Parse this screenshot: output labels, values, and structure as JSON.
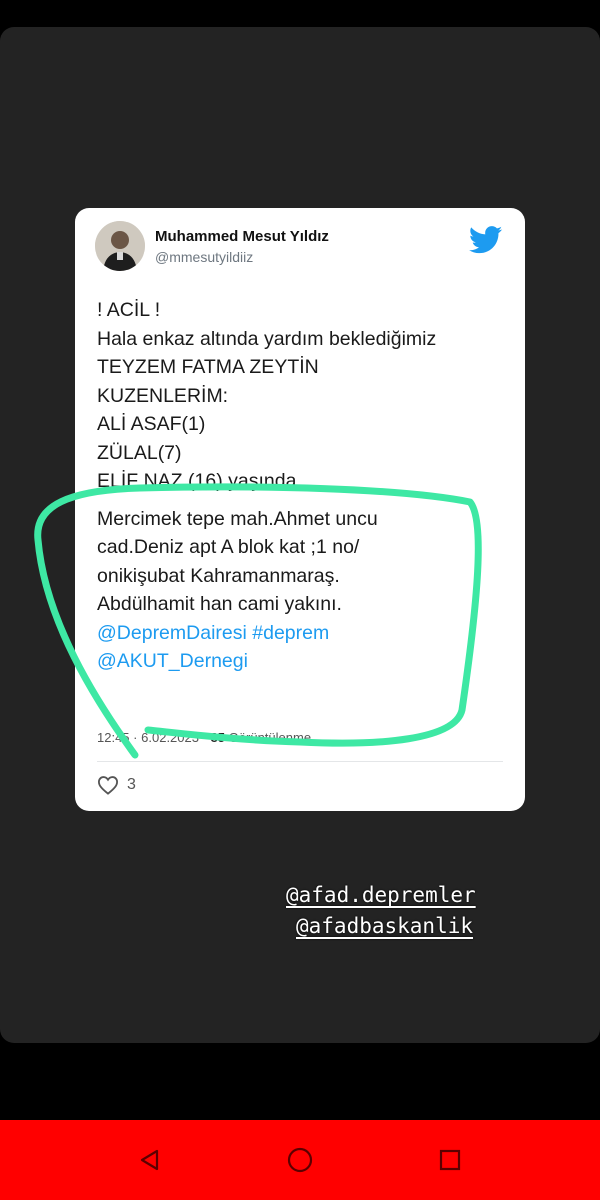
{
  "tweet": {
    "author_name": "Muhammed Mesut Yıldız",
    "author_handle": "@mmesutyildiiz",
    "lines": [
      "! ACİL !",
      "Hala enkaz altında yardım beklediğimiz",
      "TEYZEM FATMA ZEYTİN",
      "KUZENLERİM:",
      "ALİ ASAF(1)",
      "ZÜLAL(7)",
      "ELİF NAZ (16) yaşında",
      "Mercimek tepe mah.Ahmet uncu",
      "cad.Deniz apt A blok kat ;1 no/",
      "onikişubat Kahramanmaraş.",
      "Abdülhamit han cami yakını."
    ],
    "link_line_1": "@DepremDairesi #deprem",
    "link_line_2": "@AKUT_Dernegi",
    "time": "12:45",
    "date": "6.02.2023",
    "view_count": "85",
    "view_label": "Görüntülenme",
    "like_count": "3"
  },
  "story_tags": [
    "@afad.depremler",
    "@afadbaskanlik"
  ],
  "colors": {
    "link": "#1d9bf0",
    "highlight": "#3ee8a4",
    "navbar": "#ff0000",
    "twitter_blue": "#1d9bf0"
  },
  "icons": {
    "logo": "twitter-bird-icon",
    "like": "heart-icon",
    "nav": [
      "back-triangle-icon",
      "home-circle-icon",
      "recents-square-icon"
    ]
  }
}
